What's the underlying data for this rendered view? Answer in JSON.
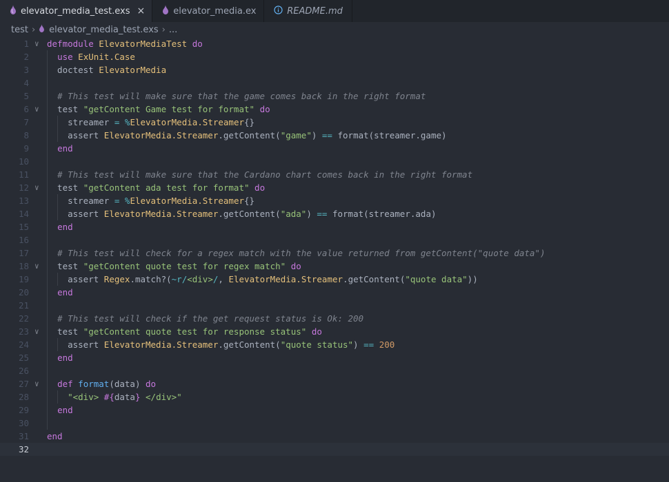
{
  "colors": {
    "editor_bg": "#282c34",
    "tabbar_bg": "#21252b",
    "keyword": "#c678dd",
    "module": "#e5c07b",
    "string": "#98c379",
    "comment": "#7f848e",
    "function": "#61afef",
    "operator": "#56b6c2",
    "number": "#d19a66",
    "text": "#abb2bf"
  },
  "tabs": [
    {
      "label": "elevator_media_test.exs",
      "icon": "elixir-drop-icon",
      "active": true,
      "close": "×"
    },
    {
      "label": "elevator_media.ex",
      "icon": "elixir-drop-icon",
      "active": false
    },
    {
      "label": "README.md",
      "icon": "info-icon",
      "active": false
    }
  ],
  "breadcrumb": {
    "folder": "test",
    "file": "elevator_media_test.exs",
    "more": "..."
  },
  "editor": {
    "current_line": 32,
    "lines": [
      {
        "n": "1",
        "fold": true,
        "tokens": [
          [
            "kw",
            "defmodule"
          ],
          [
            "pl",
            " "
          ],
          [
            "mod",
            "ElevatorMediaTest"
          ],
          [
            "pl",
            " "
          ],
          [
            "kw",
            "do"
          ]
        ]
      },
      {
        "n": "2",
        "tokens": [
          [
            "pl",
            "  "
          ],
          [
            "kw",
            "use"
          ],
          [
            "pl",
            " "
          ],
          [
            "mod",
            "ExUnit.Case"
          ]
        ]
      },
      {
        "n": "3",
        "tokens": [
          [
            "pl",
            "  doctest "
          ],
          [
            "mod",
            "ElevatorMedia"
          ]
        ]
      },
      {
        "n": "4",
        "tokens": []
      },
      {
        "n": "5",
        "tokens": [
          [
            "pl",
            "  "
          ],
          [
            "com",
            "# This test will make sure that the game comes back in the right format"
          ]
        ]
      },
      {
        "n": "6",
        "fold": true,
        "tokens": [
          [
            "pl",
            "  test "
          ],
          [
            "str",
            "\"getContent Game test for format\""
          ],
          [
            "pl",
            " "
          ],
          [
            "kw",
            "do"
          ]
        ]
      },
      {
        "n": "7",
        "tokens": [
          [
            "pl",
            "    streamer "
          ],
          [
            "op",
            "="
          ],
          [
            "pl",
            " "
          ],
          [
            "op",
            "%"
          ],
          [
            "mod",
            "ElevatorMedia.Streamer"
          ],
          [
            "pl",
            "{}"
          ]
        ]
      },
      {
        "n": "8",
        "tokens": [
          [
            "pl",
            "    assert "
          ],
          [
            "mod",
            "ElevatorMedia.Streamer"
          ],
          [
            "pl",
            ".getContent("
          ],
          [
            "str",
            "\"game\""
          ],
          [
            "pl",
            ") "
          ],
          [
            "op",
            "=="
          ],
          [
            "pl",
            " format(streamer.game)"
          ]
        ]
      },
      {
        "n": "9",
        "tokens": [
          [
            "pl",
            "  "
          ],
          [
            "kw",
            "end"
          ]
        ]
      },
      {
        "n": "10",
        "tokens": []
      },
      {
        "n": "11",
        "tokens": [
          [
            "pl",
            "  "
          ],
          [
            "com",
            "# This test will make sure that the Cardano chart comes back in the right format"
          ]
        ]
      },
      {
        "n": "12",
        "fold": true,
        "tokens": [
          [
            "pl",
            "  test "
          ],
          [
            "str",
            "\"getContent ada test for format\""
          ],
          [
            "pl",
            " "
          ],
          [
            "kw",
            "do"
          ]
        ]
      },
      {
        "n": "13",
        "tokens": [
          [
            "pl",
            "    streamer "
          ],
          [
            "op",
            "="
          ],
          [
            "pl",
            " "
          ],
          [
            "op",
            "%"
          ],
          [
            "mod",
            "ElevatorMedia.Streamer"
          ],
          [
            "pl",
            "{}"
          ]
        ]
      },
      {
        "n": "14",
        "tokens": [
          [
            "pl",
            "    assert "
          ],
          [
            "mod",
            "ElevatorMedia.Streamer"
          ],
          [
            "pl",
            ".getContent("
          ],
          [
            "str",
            "\"ada\""
          ],
          [
            "pl",
            ") "
          ],
          [
            "op",
            "=="
          ],
          [
            "pl",
            " format(streamer.ada)"
          ]
        ]
      },
      {
        "n": "15",
        "tokens": [
          [
            "pl",
            "  "
          ],
          [
            "kw",
            "end"
          ]
        ]
      },
      {
        "n": "16",
        "tokens": []
      },
      {
        "n": "17",
        "tokens": [
          [
            "pl",
            "  "
          ],
          [
            "com",
            "# This test will check for a regex match with the value returned from getContent(\"quote data\")"
          ]
        ]
      },
      {
        "n": "18",
        "fold": true,
        "tokens": [
          [
            "pl",
            "  test "
          ],
          [
            "str",
            "\"getContent quote test for regex match\""
          ],
          [
            "pl",
            " "
          ],
          [
            "kw",
            "do"
          ]
        ]
      },
      {
        "n": "19",
        "tokens": [
          [
            "pl",
            "    assert "
          ],
          [
            "mod",
            "Regex"
          ],
          [
            "pl",
            ".match?("
          ],
          [
            "op",
            "~r/"
          ],
          [
            "str",
            "<div>"
          ],
          [
            "op",
            "/"
          ],
          [
            "pl",
            ", "
          ],
          [
            "mod",
            "ElevatorMedia.Streamer"
          ],
          [
            "pl",
            ".getContent("
          ],
          [
            "str",
            "\"quote data\""
          ],
          [
            "pl",
            "))"
          ]
        ]
      },
      {
        "n": "20",
        "tokens": [
          [
            "pl",
            "  "
          ],
          [
            "kw",
            "end"
          ]
        ]
      },
      {
        "n": "21",
        "tokens": []
      },
      {
        "n": "22",
        "tokens": [
          [
            "pl",
            "  "
          ],
          [
            "com",
            "# This test will check if the get request status is Ok: 200"
          ]
        ]
      },
      {
        "n": "23",
        "fold": true,
        "tokens": [
          [
            "pl",
            "  test "
          ],
          [
            "str",
            "\"getContent quote test for response status\""
          ],
          [
            "pl",
            " "
          ],
          [
            "kw",
            "do"
          ]
        ]
      },
      {
        "n": "24",
        "tokens": [
          [
            "pl",
            "    assert "
          ],
          [
            "mod",
            "ElevatorMedia.Streamer"
          ],
          [
            "pl",
            ".getContent("
          ],
          [
            "str",
            "\"quote status\""
          ],
          [
            "pl",
            ") "
          ],
          [
            "op",
            "=="
          ],
          [
            "pl",
            " "
          ],
          [
            "num",
            "200"
          ]
        ]
      },
      {
        "n": "25",
        "tokens": [
          [
            "pl",
            "  "
          ],
          [
            "kw",
            "end"
          ]
        ]
      },
      {
        "n": "26",
        "tokens": []
      },
      {
        "n": "27",
        "fold": true,
        "tokens": [
          [
            "pl",
            "  "
          ],
          [
            "kw",
            "def"
          ],
          [
            "pl",
            " "
          ],
          [
            "fn",
            "format"
          ],
          [
            "pl",
            "(data) "
          ],
          [
            "kw",
            "do"
          ]
        ]
      },
      {
        "n": "28",
        "tokens": [
          [
            "pl",
            "    "
          ],
          [
            "str",
            "\"<div> "
          ],
          [
            "kw",
            "#{"
          ],
          [
            "pl",
            "data"
          ],
          [
            "kw",
            "}"
          ],
          [
            "str",
            " </div>\""
          ]
        ]
      },
      {
        "n": "29",
        "tokens": [
          [
            "pl",
            "  "
          ],
          [
            "kw",
            "end"
          ]
        ]
      },
      {
        "n": "30",
        "tokens": []
      },
      {
        "n": "31",
        "tokens": [
          [
            "kw",
            "end"
          ]
        ]
      },
      {
        "n": "32",
        "tokens": []
      }
    ]
  }
}
